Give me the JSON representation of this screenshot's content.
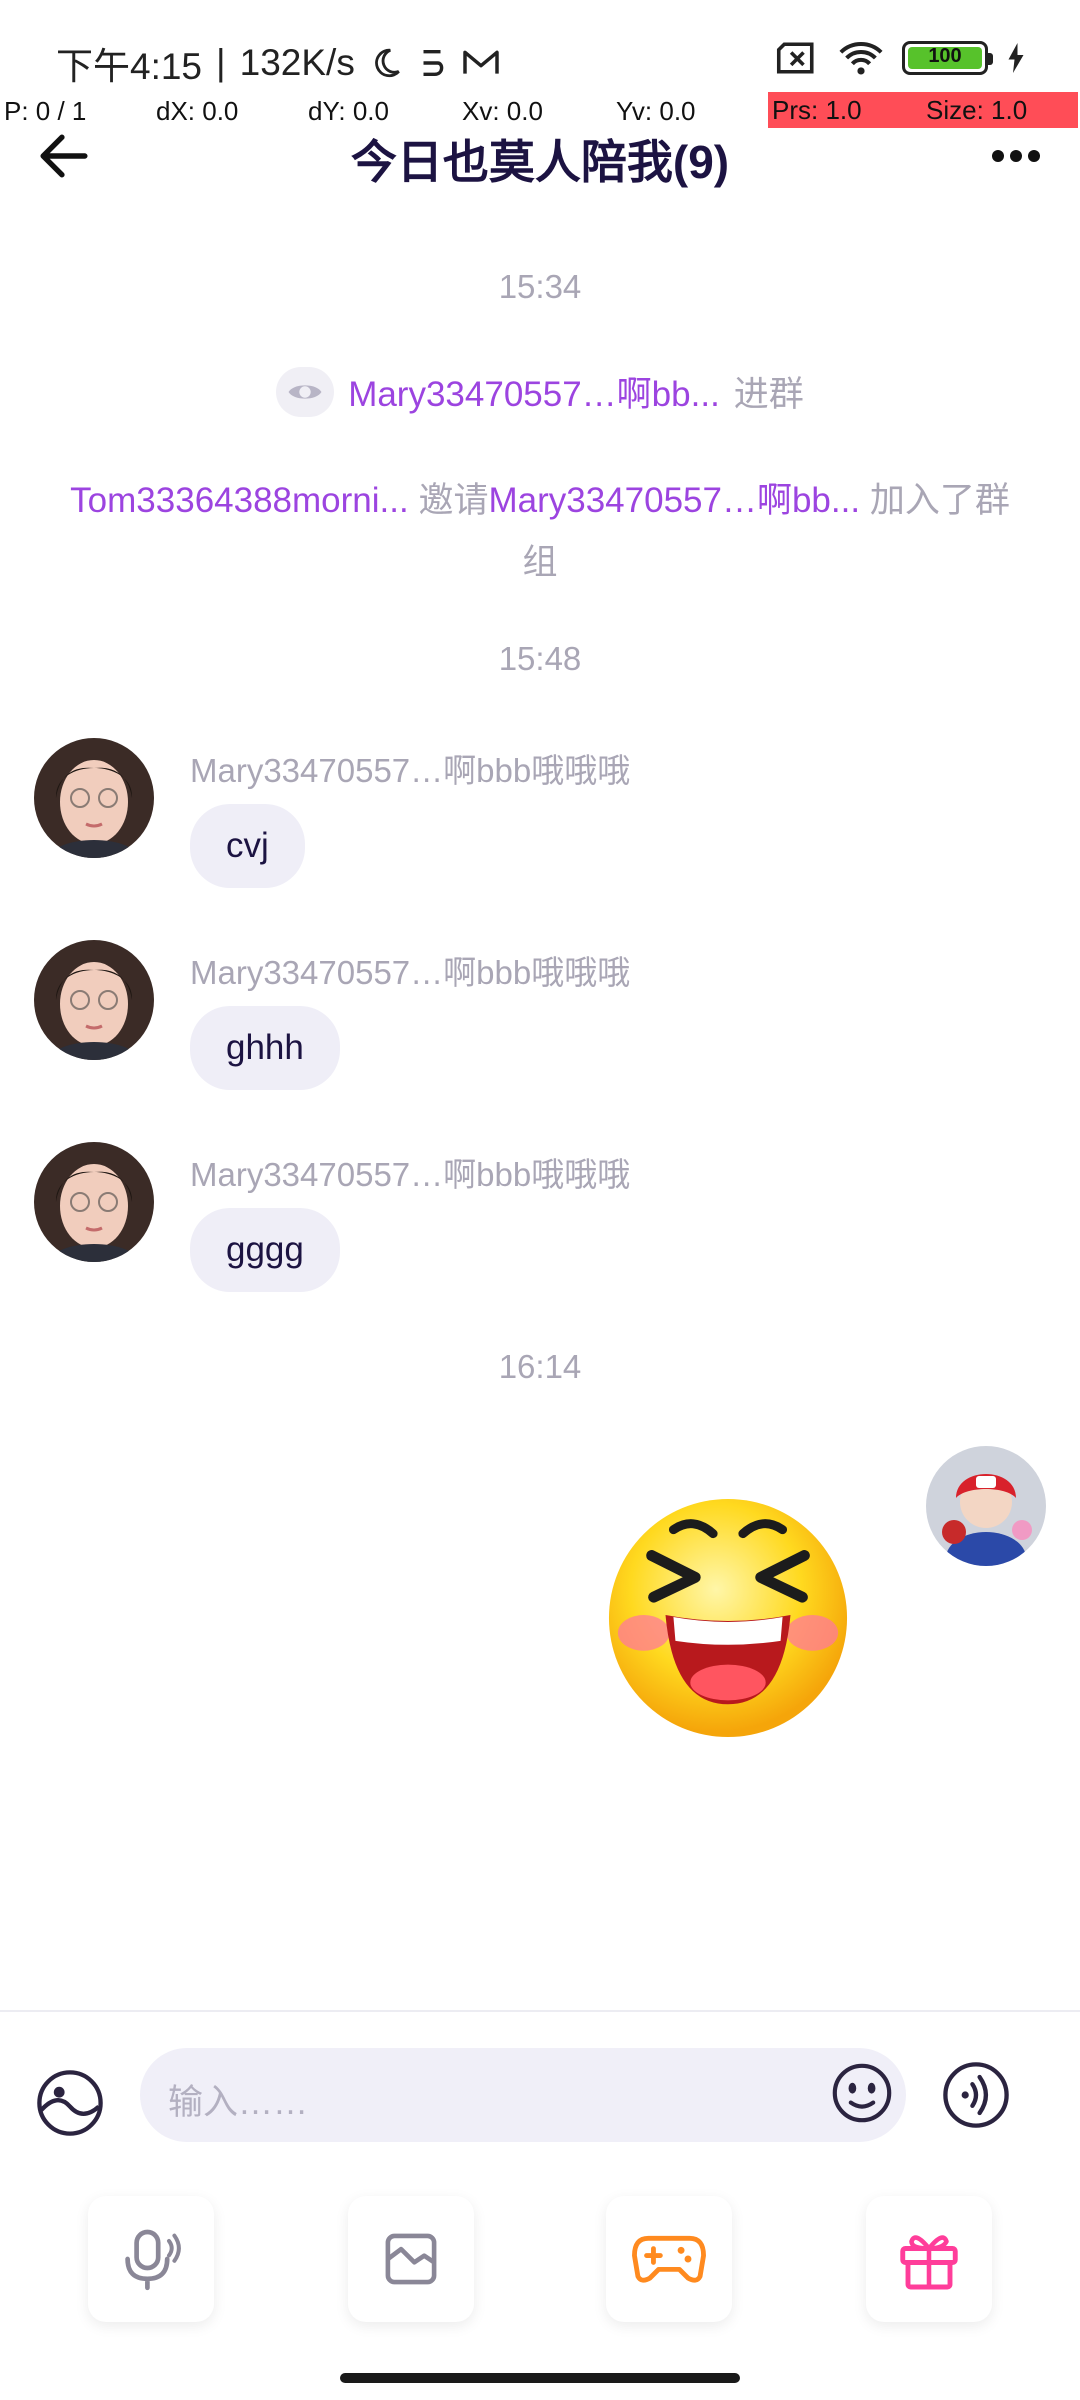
{
  "status_bar": {
    "time": "下午4:15",
    "speed": "132K/s",
    "battery": "100"
  },
  "debug_overlay": {
    "p": "P: 0 / 1",
    "dx": "dX: 0.0",
    "dy": "dY: 0.0",
    "xv": "Xv: 0.0",
    "yv": "Yv: 0.0",
    "prs": "Prs: 1.0",
    "size": "Size: 1.0"
  },
  "header": {
    "title": "今日也莫人陪我(9)"
  },
  "chat": {
    "time_1": "15:34",
    "join_notice": {
      "user": "Mary33470557…啊bb...",
      "action": "进群"
    },
    "invite_notice": {
      "inviter": "Tom33364388morni...",
      "verb": "邀请",
      "invitee": "Mary33470557…啊bb...",
      "action": "加入了群组"
    },
    "time_2": "15:48",
    "messages": [
      {
        "sender": "Mary33470557…啊bbb哦哦哦",
        "text": "cvj"
      },
      {
        "sender": "Mary33470557…啊bbb哦哦哦",
        "text": "ghhh"
      },
      {
        "sender": "Mary33470557…啊bbb哦哦哦",
        "text": "gggg"
      }
    ],
    "time_3": "16:14"
  },
  "input": {
    "placeholder": "输入……"
  },
  "colors": {
    "accent_purple": "#9c44e0",
    "bubble_bg": "#efeef7",
    "title_color": "#1c1342",
    "gift_pink": "#ff3d9a",
    "game_orange": "#ff8a1f"
  }
}
